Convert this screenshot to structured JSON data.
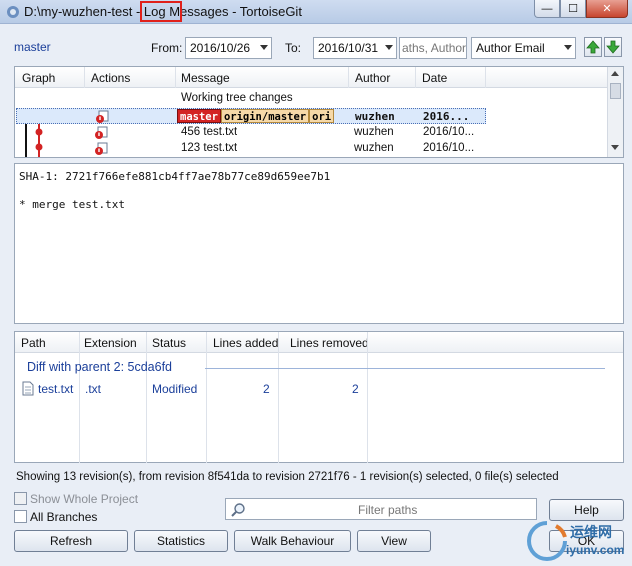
{
  "window": {
    "title_path": "D:\\my-wuzhen-test - ",
    "title_highlight": "Log Messages",
    "title_app": " - TortoiseGit",
    "buttons": {
      "minimize": "—",
      "maximize": "☐",
      "close": "✕"
    }
  },
  "toolbar": {
    "branch": "master",
    "from_label": "From:",
    "from_date": "2016/10/26",
    "to_label": "To:",
    "to_date": "2016/10/31",
    "search_in_partial": "aths, Authors",
    "filter_field": "Author Email"
  },
  "log": {
    "columns": [
      "Graph",
      "Actions",
      "Message",
      "Author",
      "Date"
    ],
    "working_tree": "Working tree changes",
    "rows": [
      {
        "tags": [
          "master",
          "origin/master",
          "ori"
        ],
        "author": "wuzhen",
        "date": "2016..."
      },
      {
        "message": "456 test.txt",
        "author": "wuzhen",
        "date": "2016/10..."
      },
      {
        "message": "123 test.txt",
        "author": "wuzhen",
        "date": "2016/10..."
      }
    ]
  },
  "message_pane": {
    "sha": "SHA-1: 2721f766efe881cb4ff7ae78b77ce89d659ee7b1",
    "body": "* merge test.txt"
  },
  "files": {
    "columns": [
      "Path",
      "Extension",
      "Status",
      "Lines added",
      "Lines removed"
    ],
    "group": "Diff with parent 2: 5cda6fd",
    "rows": [
      {
        "path": "test.txt",
        "extension": ".txt",
        "status": "Modified",
        "added": "2",
        "removed": "2"
      }
    ]
  },
  "status": "Showing 13 revision(s), from revision 8f541da to revision 2721f76 - 1 revision(s) selected, 0 file(s) selected",
  "options": {
    "show_whole_project": "Show Whole Project",
    "all_branches": "All Branches",
    "filter_placeholder": "Filter paths"
  },
  "buttons": {
    "refresh": "Refresh",
    "statistics": "Statistics",
    "walk": "Walk Behaviour",
    "view": "View",
    "help": "Help",
    "ok": "OK"
  },
  "watermark": {
    "line1": "运维网",
    "line2": "iyunv.com"
  },
  "colors": {
    "master_tag": "#d32323",
    "remote_tag": "#f6d9a8",
    "link": "#1b3f9a",
    "highlight_box": "#e0211b"
  }
}
